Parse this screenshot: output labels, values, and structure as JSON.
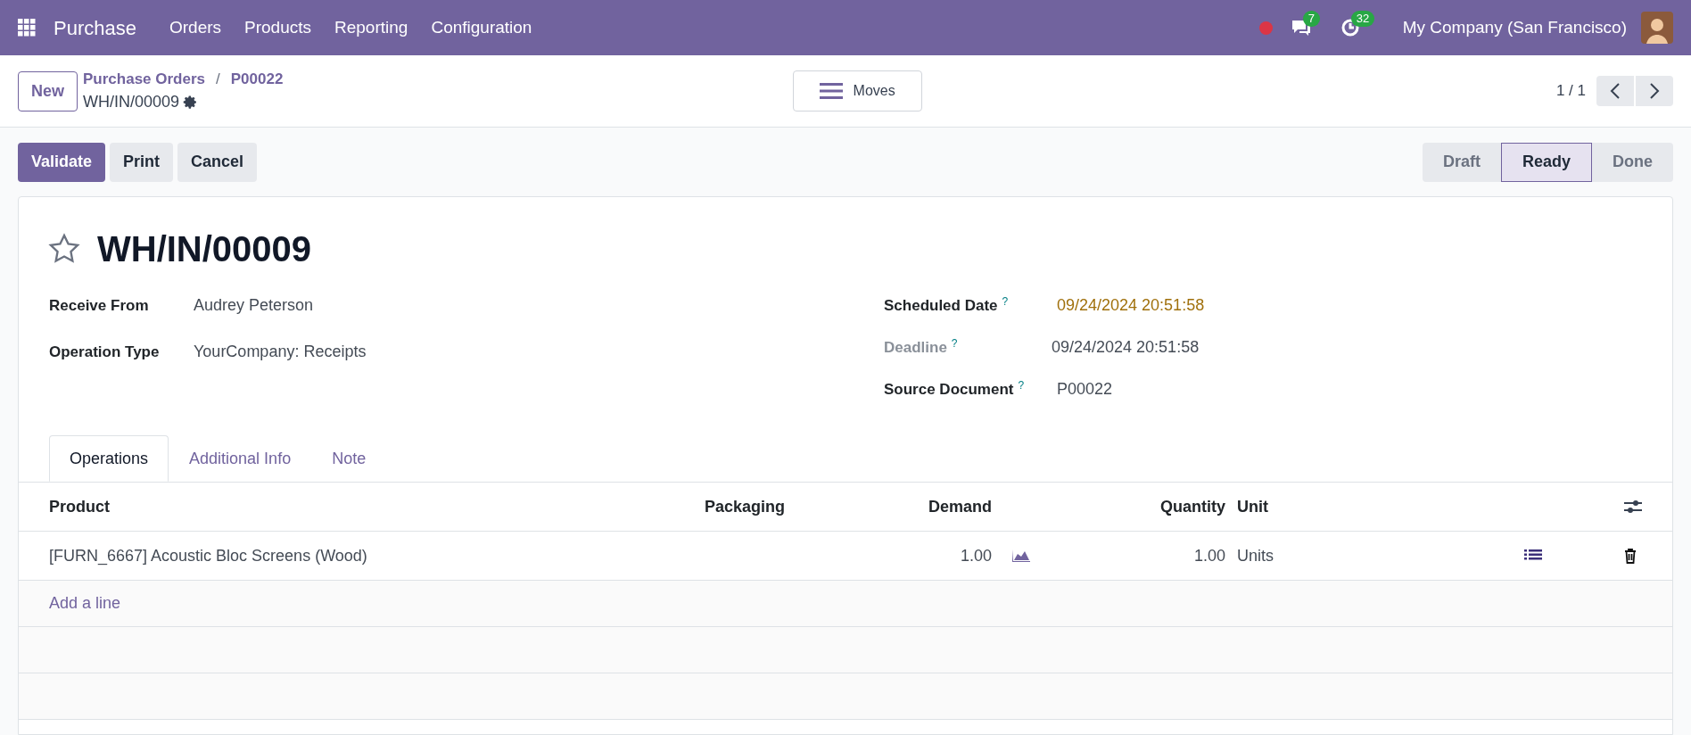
{
  "navbar": {
    "app": "Purchase",
    "menus": [
      "Orders",
      "Products",
      "Reporting",
      "Configuration"
    ],
    "messages_count": "7",
    "activities_count": "32",
    "company": "My Company (San Francisco)"
  },
  "control_panel": {
    "new_button": "New",
    "breadcrumbs": [
      "Purchase Orders",
      "P00022"
    ],
    "breadcrumb_separator": "/",
    "record": "WH/IN/00009",
    "moves_button": "Moves",
    "pager": "1 / 1"
  },
  "actions": [
    "Validate",
    "Print",
    "Cancel"
  ],
  "statusbar": [
    {
      "label": "Draft",
      "selected": false
    },
    {
      "label": "Ready",
      "selected": true
    },
    {
      "label": "Done",
      "selected": false
    }
  ],
  "form": {
    "title": "WH/IN/00009",
    "starred": false,
    "left_fields": [
      {
        "label": "Receive From",
        "value": "Audrey Peterson"
      },
      {
        "label": "Operation Type",
        "value": "YourCompany: Receipts"
      }
    ],
    "right_fields": [
      {
        "label": "Scheduled Date",
        "help": "?",
        "value": "09/24/2024 20:51:58",
        "kind": "warning"
      },
      {
        "label": "Deadline",
        "help": "?",
        "value": "09/24/2024 20:51:58",
        "kind": "muted"
      },
      {
        "label": "Source Document",
        "help": "?",
        "value": "P00022",
        "kind": "normal"
      }
    ]
  },
  "tabs": [
    {
      "label": "Operations",
      "selected": true
    },
    {
      "label": "Additional Info",
      "selected": false
    },
    {
      "label": "Note",
      "selected": false
    }
  ],
  "table": {
    "columns": [
      "Product",
      "Packaging",
      "Demand",
      "Quantity",
      "Unit"
    ],
    "rows": [
      {
        "product": "[FURN_6667] Acoustic Bloc Screens (Wood)",
        "packaging": "",
        "demand": "1.00",
        "quantity": "1.00",
        "unit": "Units"
      }
    ],
    "add_line": "Add a line"
  }
}
